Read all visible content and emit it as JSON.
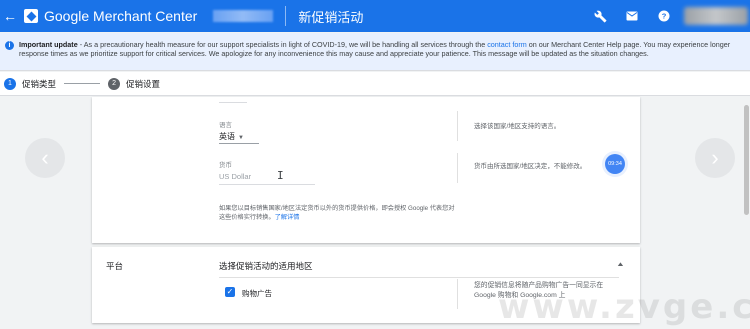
{
  "header": {
    "brand": "Google Merchant Center",
    "page_title": "新促销活动",
    "bg_color": "#1a73e8"
  },
  "banner": {
    "heading": "Important update",
    "text_before_link": " - As a precautionary health measure for our support specialists in light of COVID-19, we will be handling all services through the ",
    "link": "contact form",
    "text_after_link": " on our Merchant Center Help page. You may experience longer response times as we prioritize support for critical services. We apologize for any inconvenience this may cause and appreciate your patience. This message will be updated as the situation changes."
  },
  "stepper": {
    "steps": [
      {
        "num": "1",
        "label": "促销类型",
        "active": true
      },
      {
        "num": "2",
        "label": "促销设置",
        "active": false
      }
    ]
  },
  "card1": {
    "language": {
      "label": "语言",
      "value": "英语",
      "help": "选择该国家/地区支持的语言。"
    },
    "currency": {
      "label": "货币",
      "value": "US Dollar",
      "help": "货币由所选国家/地区决定，不能修改。"
    },
    "note_text": "如果您以目标销售国家/地区法定货币以外的货币提供价格，即会授权 Google 代表您对这些价格实行转换。",
    "note_link": "了解详情",
    "fab_time": "09:34"
  },
  "card2": {
    "section_title": "平台",
    "subtitle": "选择促销活动的适用地区",
    "checkbox_label": "购物广告",
    "checkbox_checked": true,
    "help": "您的促销信息将随产品购物广告一同显示在 Google 购物和 Google.com 上"
  },
  "icons": {
    "back": "back-arrow-icon",
    "tools": "wrench-icon",
    "mail": "mail-icon",
    "help": "help-icon",
    "info": "info-icon",
    "prev": "chevron-left-icon",
    "next": "chevron-right-icon",
    "collapse": "chevron-up-icon"
  },
  "watermark": "www.zvge.cn"
}
